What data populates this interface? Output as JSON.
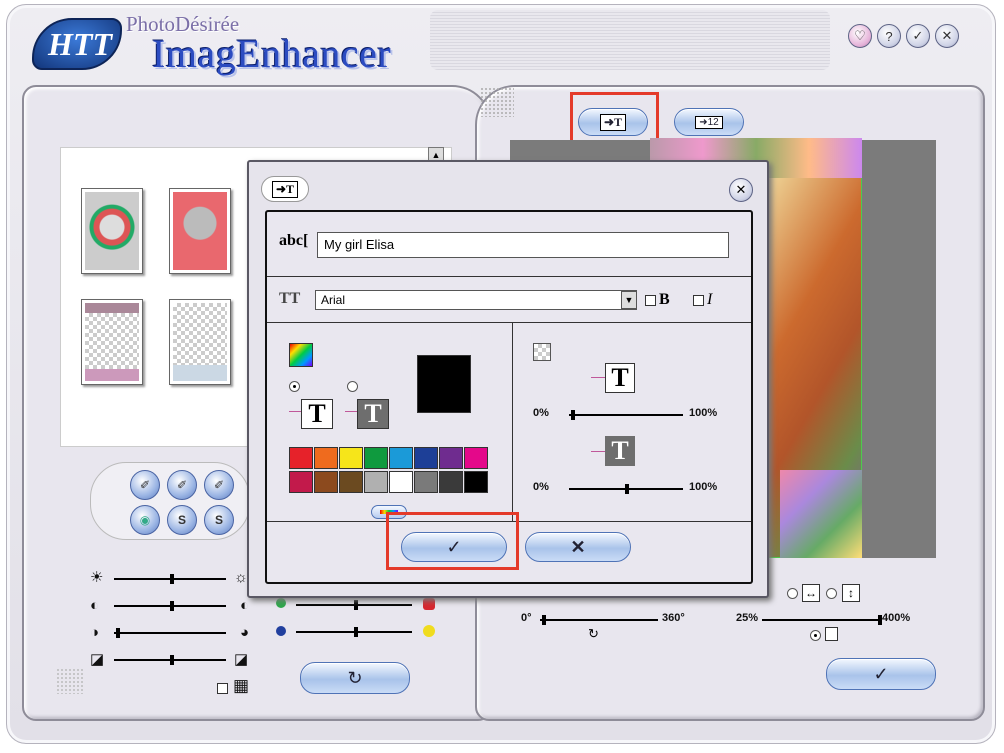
{
  "app": {
    "logo_text": "HTT",
    "brand_small": "PhotoDésirée",
    "product_name": "ImagEnhancer"
  },
  "title_buttons": [
    {
      "icon": "help-heart-icon",
      "glyph": "♡"
    },
    {
      "icon": "info-icon",
      "glyph": "?"
    },
    {
      "icon": "check-icon",
      "glyph": "✓"
    },
    {
      "icon": "close-icon",
      "glyph": "✕"
    }
  ],
  "toolbar": {
    "text_tool_glyph": "T",
    "number_tool_glyph": "12"
  },
  "left_buttons": {
    "row1": [
      "✐",
      "✐",
      "✐"
    ],
    "row2": [
      "◉",
      "S",
      "S"
    ]
  },
  "right_panel": {
    "rotate_start": "0°",
    "rotate_end": "360°",
    "zoom_start": "25%",
    "zoom_end": "400%",
    "fit_width_glyph": "↔",
    "fit_height_glyph": "↕",
    "rotate_glyph": "↻",
    "confirm_glyph": "✓"
  },
  "left_bottom": {
    "reset_glyph": "↻",
    "grid_glyph": "▦"
  },
  "dialog": {
    "text_prefix": "abc",
    "text_value": "My girl Elisa",
    "font_prefix": "TT",
    "font_value": "Arial",
    "bold_label": "B",
    "italic_label": "I",
    "color_letter": "T",
    "opacity1_start": "0%",
    "opacity1_end": "100%",
    "opacity2_start": "0%",
    "opacity2_end": "100%",
    "ok_glyph": "✓",
    "cancel_glyph": "✕",
    "close_glyph": "✕"
  },
  "palette": {
    "row1": [
      "#e6222a",
      "#ef6b1e",
      "#f6e51a",
      "#0f9a3e",
      "#1b9ad8",
      "#1d3f97",
      "#6f2c8f",
      "#e4088a"
    ],
    "row2": [
      "#c21a4b",
      "#8c4a1e",
      "#6b4a20",
      "#b0b0b0",
      "#ffffff",
      "#7a7a7a",
      "#3a3a3a",
      "#000000"
    ],
    "selected_color": "#000000"
  },
  "colors": {
    "accent_red": "#e43a2a",
    "button_blue": "#a9c3ea"
  }
}
